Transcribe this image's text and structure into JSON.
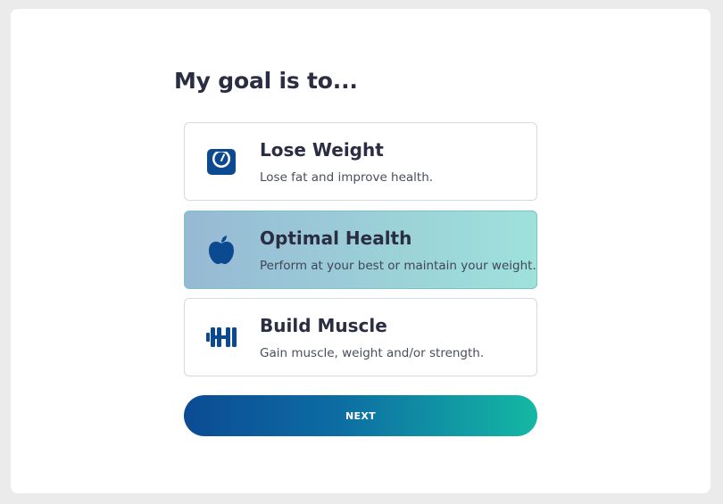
{
  "heading": "My goal is to...",
  "options": [
    {
      "icon": "scale-icon",
      "title": "Lose Weight",
      "description": "Lose fat and improve health.",
      "selected": false
    },
    {
      "icon": "apple-icon",
      "title": "Optimal Health",
      "description": "Perform at your best or maintain your weight.",
      "selected": true
    },
    {
      "icon": "dumbbell-icon",
      "title": "Build Muscle",
      "description": "Gain muscle, weight and/or strength.",
      "selected": false
    }
  ],
  "next_button": "NEXT",
  "colors": {
    "heading_text": "#2b2d42",
    "icon": "#0b4a90",
    "selected_gradient_start": "#97b9d4",
    "selected_gradient_end": "#9ee2db",
    "button_gradient_start": "#0b4b94",
    "button_gradient_end": "#14b8a4"
  }
}
